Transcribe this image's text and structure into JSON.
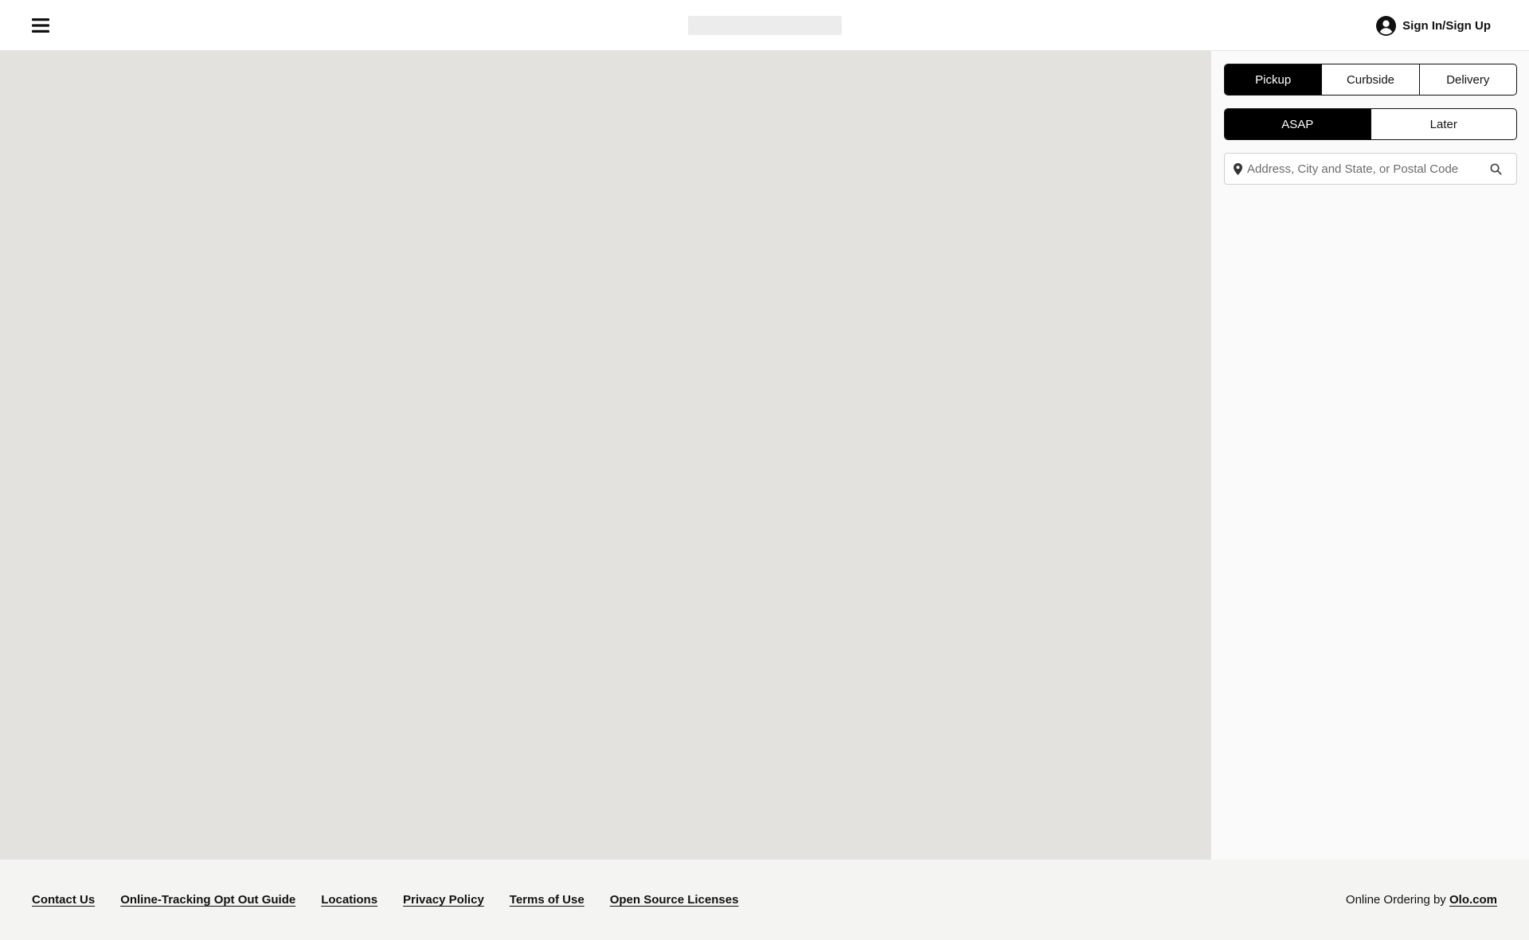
{
  "header": {
    "signin_label": "Sign In/Sign Up"
  },
  "order_modes": [
    {
      "label": "Pickup",
      "active": true
    },
    {
      "label": "Curbside",
      "active": false
    },
    {
      "label": "Delivery",
      "active": false
    }
  ],
  "timing": [
    {
      "label": "ASAP",
      "active": true
    },
    {
      "label": "Later",
      "active": false
    }
  ],
  "search": {
    "placeholder": "Address, City and State, or Postal Code",
    "value": ""
  },
  "footer": {
    "links": [
      "Contact Us",
      "Online-Tracking Opt Out Guide",
      "Locations",
      "Privacy Policy",
      "Terms of Use",
      "Open Source Licenses"
    ],
    "credit_prefix": "Online Ordering by ",
    "credit_link": "Olo.com"
  },
  "colors": {
    "map_bg": "#e3e2de",
    "panel_bg": "#fafafa",
    "footer_bg": "#f4f4f3",
    "active_bg": "#000000"
  },
  "icons": {
    "menu": "hamburger-menu-icon",
    "account": "user-circle-icon",
    "location": "map-pin-icon",
    "search": "magnifier-icon",
    "accessibility": "accessibility-toggle-icon"
  }
}
